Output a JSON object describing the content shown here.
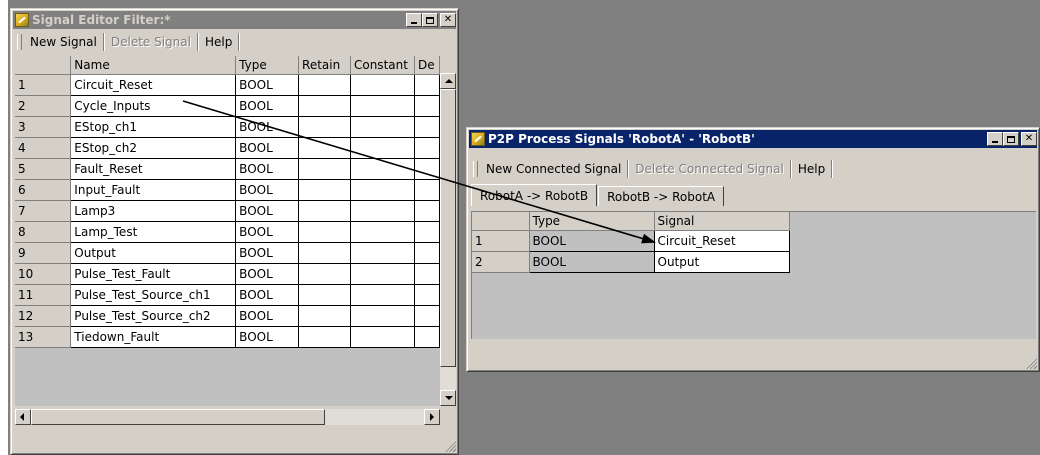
{
  "signal_editor": {
    "title": "Signal Editor Filter:*",
    "toolbar": {
      "new_signal": "New Signal",
      "delete_signal": "Delete Signal",
      "help": "Help"
    },
    "columns": [
      "Name",
      "Type",
      "Retain",
      "Constant",
      "De"
    ],
    "rows": [
      {
        "num": "1",
        "name": "Circuit_Reset",
        "type": "BOOL"
      },
      {
        "num": "2",
        "name": "Cycle_Inputs",
        "type": "BOOL"
      },
      {
        "num": "3",
        "name": "EStop_ch1",
        "type": "BOOL"
      },
      {
        "num": "4",
        "name": "EStop_ch2",
        "type": "BOOL"
      },
      {
        "num": "5",
        "name": "Fault_Reset",
        "type": "BOOL"
      },
      {
        "num": "6",
        "name": "Input_Fault",
        "type": "BOOL"
      },
      {
        "num": "7",
        "name": "Lamp3",
        "type": "BOOL"
      },
      {
        "num": "8",
        "name": "Lamp_Test",
        "type": "BOOL"
      },
      {
        "num": "9",
        "name": "Output",
        "type": "BOOL"
      },
      {
        "num": "10",
        "name": "Pulse_Test_Fault",
        "type": "BOOL"
      },
      {
        "num": "11",
        "name": "Pulse_Test_Source_ch1",
        "type": "BOOL"
      },
      {
        "num": "12",
        "name": "Pulse_Test_Source_ch2",
        "type": "BOOL"
      },
      {
        "num": "13",
        "name": "Tiedown_Fault",
        "type": "BOOL"
      }
    ]
  },
  "p2p_window": {
    "title": "P2P Process Signals 'RobotA' - 'RobotB'",
    "toolbar": {
      "new_connected_signal": "New Connected Signal",
      "delete_connected_signal": "Delete Connected Signal",
      "help": "Help"
    },
    "tabs": [
      "RobotA -> RobotB",
      "RobotB -> RobotA"
    ],
    "columns": [
      "Type",
      "Signal"
    ],
    "rows": [
      {
        "num": "1",
        "type": "BOOL",
        "signal": "Circuit_Reset"
      },
      {
        "num": "2",
        "type": "BOOL",
        "signal": "Output"
      }
    ]
  },
  "icons": {
    "window_icon": "signal-editor-icon",
    "minimize": "minimize-icon",
    "maximize": "maximize-icon",
    "close": "close-icon",
    "arrow": "drag-connection-arrow"
  },
  "colors": {
    "desktop": "#808080",
    "face": "#d4d0c8",
    "active_title": "#0a246a",
    "inactive_title": "#808080"
  }
}
